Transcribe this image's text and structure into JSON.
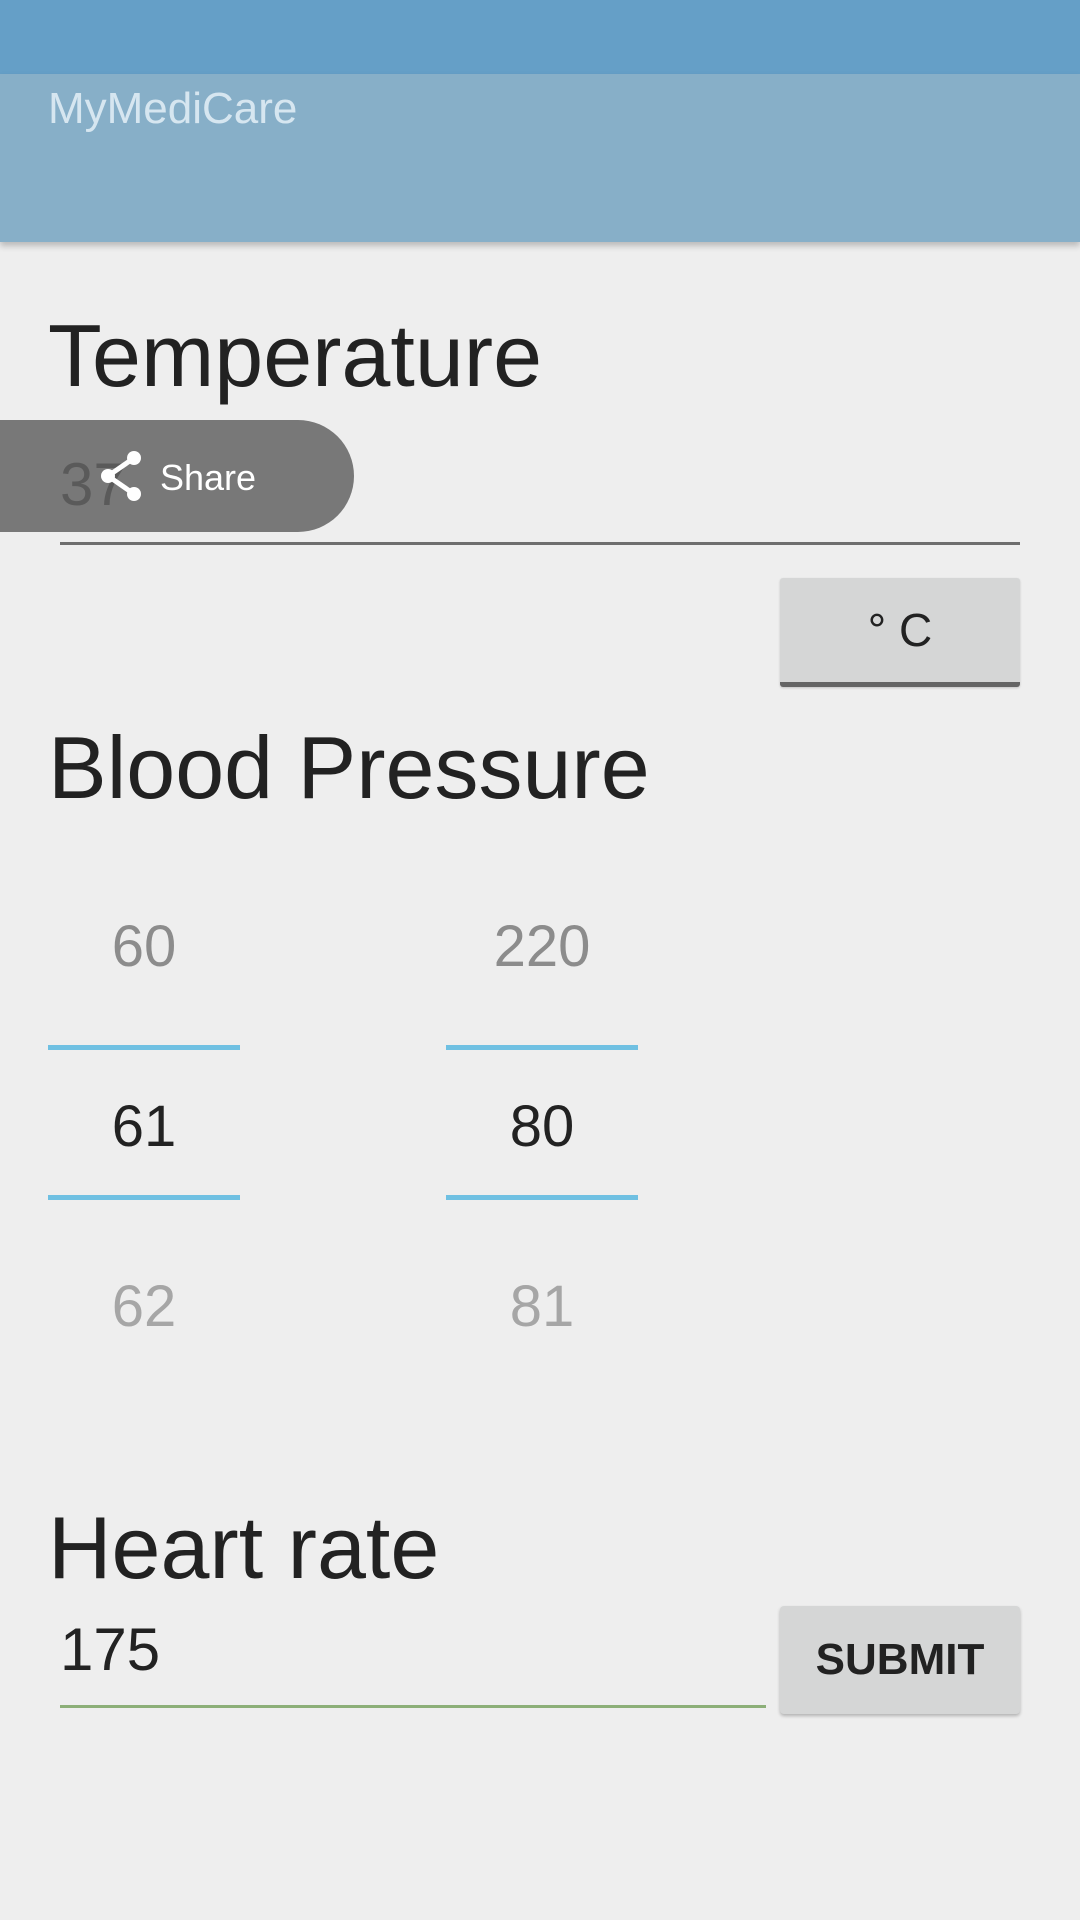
{
  "app": {
    "title": "MyMediCare"
  },
  "temperature": {
    "heading": "Temperature",
    "value": "37",
    "unit_button": "° C"
  },
  "share": {
    "label": "Share"
  },
  "blood_pressure": {
    "heading": "Blood Pressure",
    "left_picker": {
      "above": "60",
      "selected": "61",
      "below": "62"
    },
    "right_picker": {
      "above": "220",
      "selected": "80",
      "below": "81"
    }
  },
  "heart_rate": {
    "heading": "Heart rate",
    "value": "175",
    "submit_label": "SUBMIT"
  },
  "colors": {
    "status_bar": "#659fc7",
    "app_bar": "#87afc8",
    "picker_accent": "#6fc0e2",
    "background": "#eeeeee"
  }
}
